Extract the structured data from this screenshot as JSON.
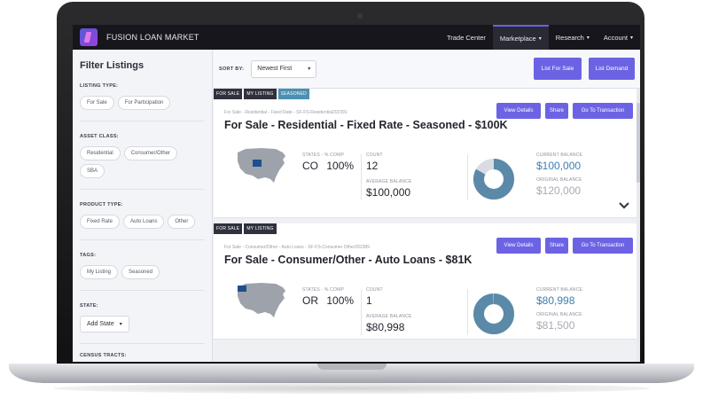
{
  "app": {
    "brand": "FUSION LOAN MARKET"
  },
  "nav": [
    {
      "label": "Trade Center",
      "caret": ""
    },
    {
      "label": "Marketplace",
      "caret": "▾"
    },
    {
      "label": "Research",
      "caret": "▾"
    },
    {
      "label": "Account",
      "caret": "▾"
    }
  ],
  "sidebar": {
    "title": "Filter Listings",
    "listing_type": {
      "label": "LISTING TYPE:",
      "options": [
        "For Sale",
        "For Participation"
      ]
    },
    "asset_class": {
      "label": "ASSET CLASS:",
      "options": [
        "Residential",
        "Consumer/Other",
        "SBA"
      ]
    },
    "product_type": {
      "label": "PRODUCT TYPE:",
      "options": [
        "Fixed Rate",
        "Auto Loans",
        "Other"
      ]
    },
    "tags": {
      "label": "TAGS:",
      "options": [
        "My Listing",
        "Seasoned"
      ]
    },
    "state": {
      "label": "STATE:",
      "value": "Add State",
      "caret": "▾"
    },
    "census": {
      "label": "CENSUS TRACTS:"
    }
  },
  "toolbar": {
    "sort_label": "SORT BY:",
    "sort_value": "Newest First",
    "sort_caret": "▾",
    "list_for_sale": "List For Sale",
    "list_demand": "List Demand"
  },
  "listings": [
    {
      "tags": [
        "FOR SALE",
        "MY LISTING",
        "SEASONED"
      ],
      "actions": [
        "View Details",
        "Share",
        "Go To Transaction"
      ],
      "subtitle": "For Sale - Residential - Fixed Rate - SF-FS-Residential202391",
      "title": "For Sale - Residential - Fixed Rate - Seasoned - $100K",
      "states_label": "STATES - % COMP",
      "state": "CO",
      "state_pct": "100%",
      "count_label": "COUNT",
      "count": "12",
      "avg_label": "AVERAGE BALANCE",
      "avg_balance": "$100,000",
      "current_label": "CURRENT BALANCE",
      "current_balance": "$100,000",
      "original_label": "ORIGINAL BALANCE",
      "original_balance": "$120,000",
      "balance_ratio": 0.83,
      "accent": "#5b89a8"
    },
    {
      "tags": [
        "FOR SALE",
        "MY LISTING"
      ],
      "actions": [
        "View Details",
        "Share",
        "Go To Transaction"
      ],
      "subtitle": "For Sale - Consumer/Other - Auto Loans - SF-FS-Consumer Other202389",
      "title": "For Sale - Consumer/Other - Auto Loans - $81K",
      "states_label": "STATES - % COMP",
      "state": "OR",
      "state_pct": "100%",
      "count_label": "COUNT",
      "count": "1",
      "avg_label": "AVERAGE BALANCE",
      "avg_balance": "$80,998",
      "current_label": "CURRENT BALANCE",
      "current_balance": "$80,998",
      "original_label": "ORIGINAL BALANCE",
      "original_balance": "$81,500",
      "balance_ratio": 0.994,
      "accent": "#5b89a8"
    }
  ],
  "colors": {
    "accent": "#6c63e4",
    "nav_bg": "#16161c",
    "donut": "#5b89a8",
    "donut_rest": "#d9dde3",
    "map_state": "#1f4e8c"
  }
}
